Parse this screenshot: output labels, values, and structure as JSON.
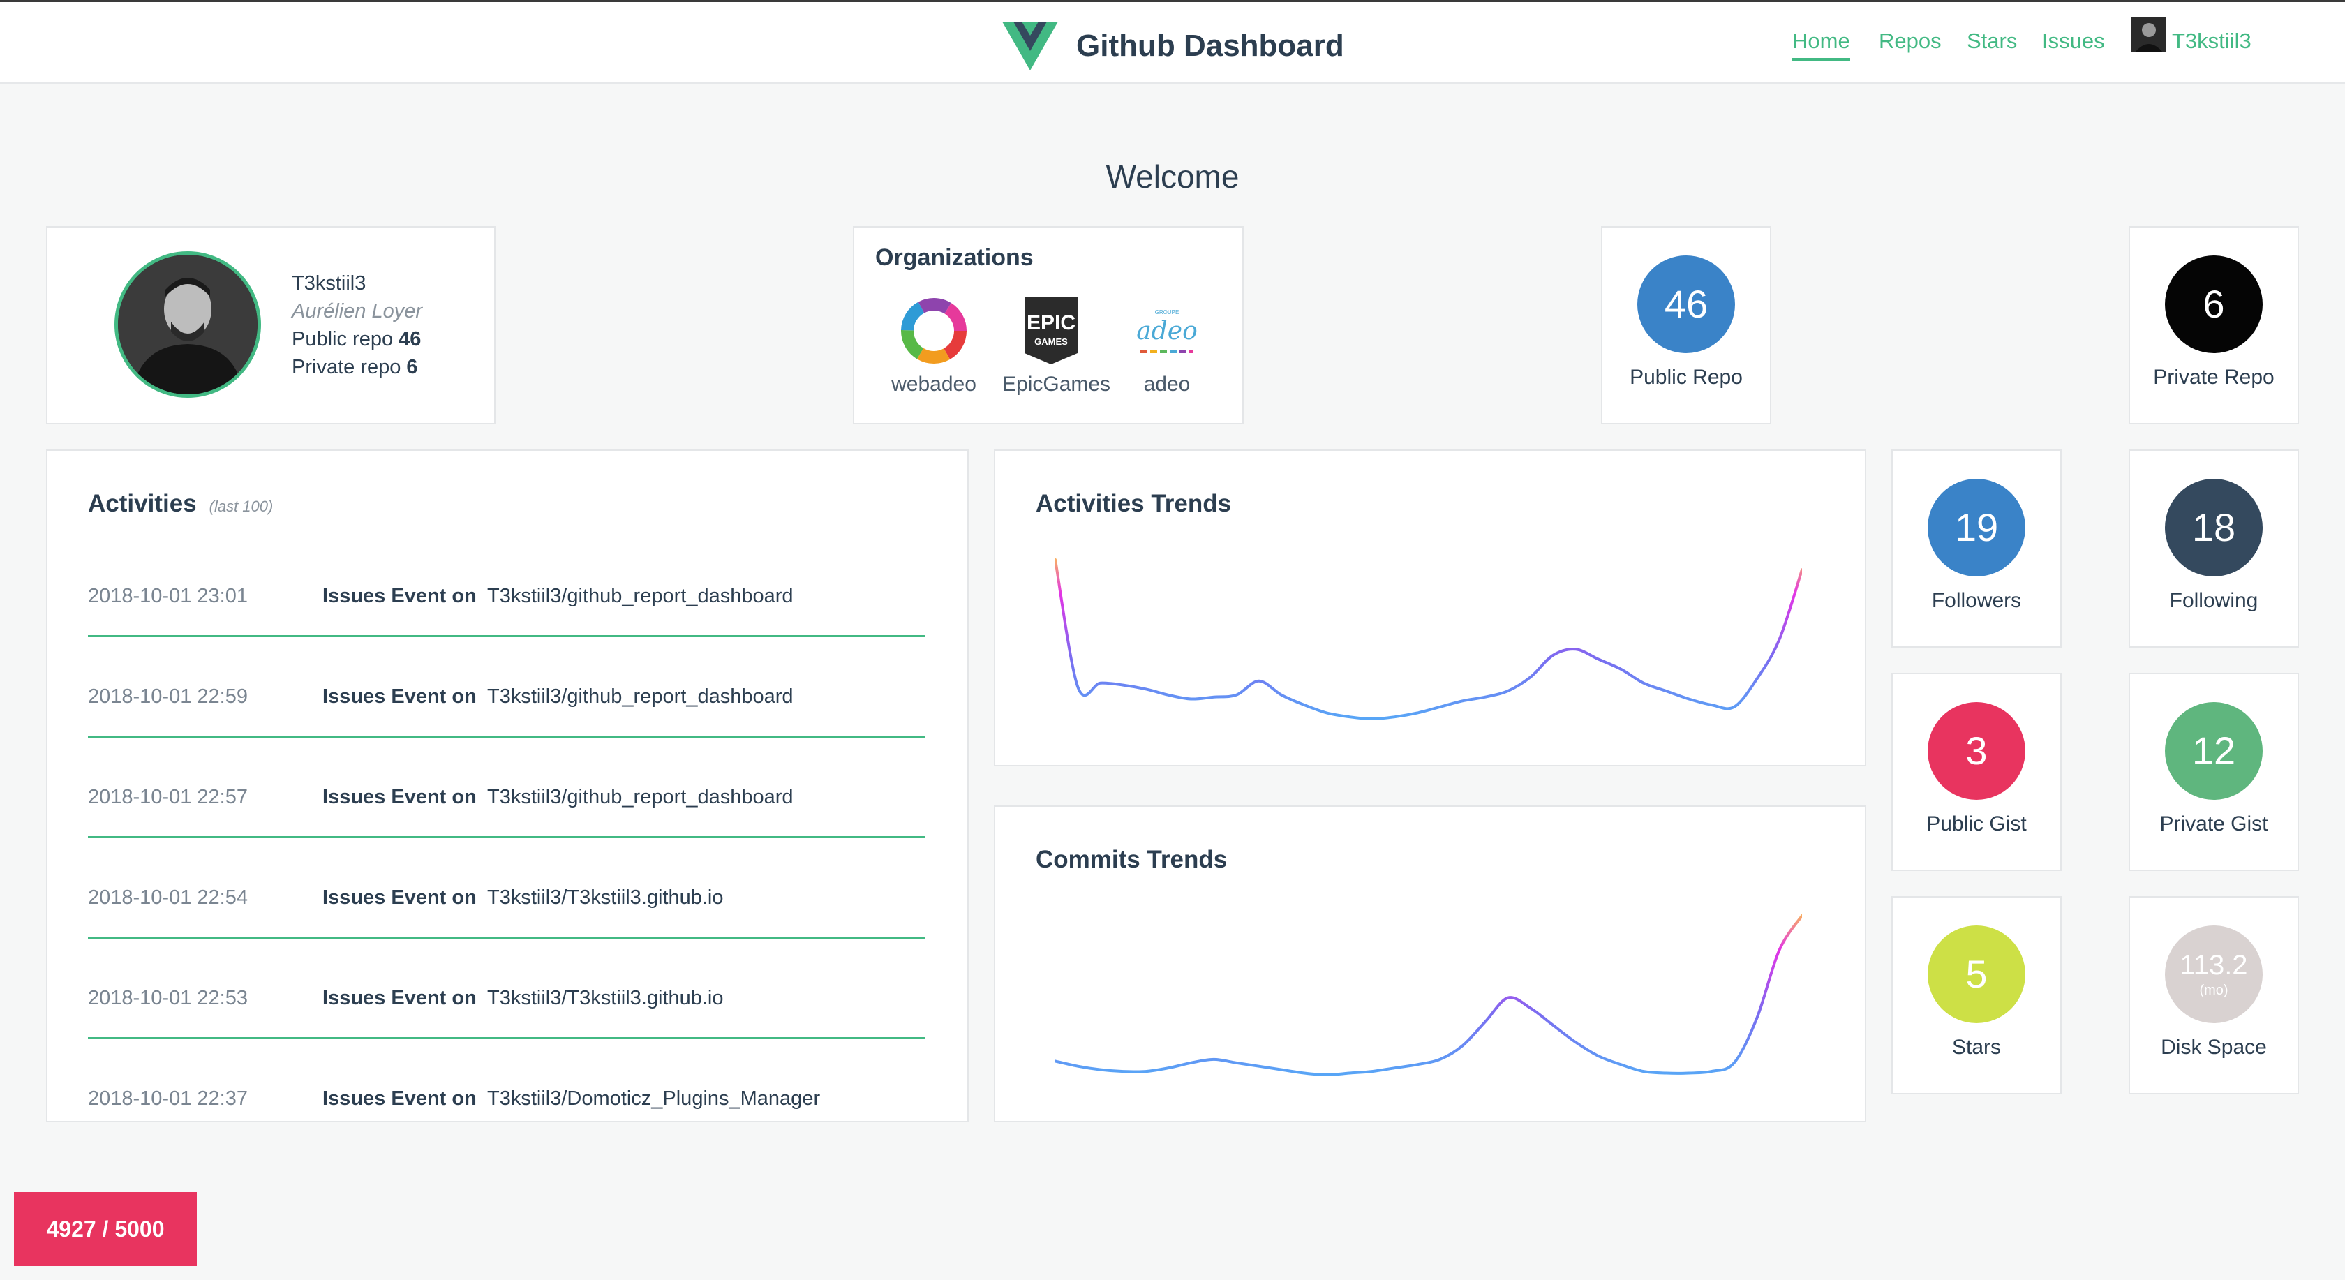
{
  "header": {
    "brand": "Github Dashboard",
    "logo_icon": "vue-logo-icon",
    "nav": [
      {
        "label": "Home",
        "active": true
      },
      {
        "label": "Repos",
        "active": false
      },
      {
        "label": "Stars",
        "active": false
      },
      {
        "label": "Issues",
        "active": false
      }
    ],
    "user": "T3kstiil3"
  },
  "welcome": "Welcome",
  "profile": {
    "login": "T3kstiil3",
    "name": "Aurélien Loyer",
    "public_repo_label": "Public repo",
    "public_repo_value": "46",
    "private_repo_label": "Private repo",
    "private_repo_value": "6"
  },
  "organizations": {
    "title": "Organizations",
    "items": [
      {
        "name": "webadeo",
        "icon": "webadeo-logo-icon"
      },
      {
        "name": "EpicGames",
        "icon": "epicgames-logo-icon",
        "logo_text_top": "EPIC",
        "logo_text_bottom": "GAMES"
      },
      {
        "name": "adeo",
        "icon": "adeo-logo-icon",
        "logo_text_top": "GROUPE",
        "logo_text_main": "adeo"
      }
    ]
  },
  "stats": {
    "public_repo": {
      "value": "46",
      "label": "Public Repo",
      "color": "#3a83c8"
    },
    "private_repo": {
      "value": "6",
      "label": "Private Repo",
      "color": "#050505"
    },
    "followers": {
      "value": "19",
      "label": "Followers",
      "color": "#3a83c8"
    },
    "following": {
      "value": "18",
      "label": "Following",
      "color": "#34495e"
    },
    "public_gist": {
      "value": "3",
      "label": "Public Gist",
      "color": "#e8345f"
    },
    "private_gist": {
      "value": "12",
      "label": "Private Gist",
      "color": "#5fb67e"
    },
    "stars": {
      "value": "5",
      "label": "Stars",
      "color": "#cde046"
    },
    "disk_space": {
      "value": "113.2",
      "unit": "(mo)",
      "label": "Disk Space",
      "color": "#d9d2d1"
    }
  },
  "activities": {
    "title": "Activities",
    "subtitle": "(last 100)",
    "items": [
      {
        "date": "2018-10-01 23:01",
        "type": "Issues Event on",
        "repo": "T3kstiil3/github_report_dashboard"
      },
      {
        "date": "2018-10-01 22:59",
        "type": "Issues Event on",
        "repo": "T3kstiil3/github_report_dashboard"
      },
      {
        "date": "2018-10-01 22:57",
        "type": "Issues Event on",
        "repo": "T3kstiil3/github_report_dashboard"
      },
      {
        "date": "2018-10-01 22:54",
        "type": "Issues Event on",
        "repo": "T3kstiil3/T3kstiil3.github.io"
      },
      {
        "date": "2018-10-01 22:53",
        "type": "Issues Event on",
        "repo": "T3kstiil3/T3kstiil3.github.io"
      },
      {
        "date": "2018-10-01 22:37",
        "type": "Issues Event on",
        "repo": "T3kstiil3/Domoticz_Plugins_Manager"
      }
    ]
  },
  "activities_trends": {
    "title": "Activities Trends"
  },
  "commits_trends": {
    "title": "Commits Trends"
  },
  "chart_data": [
    {
      "type": "line",
      "title": "Activities Trends",
      "values": [
        10,
        3.6,
        3.8,
        3.7,
        3.5,
        3.2,
        3.0,
        3.1,
        3.2,
        3.9,
        3.2,
        2.7,
        2.3,
        2.1,
        2.0,
        2.1,
        2.3,
        2.6,
        2.9,
        3.1,
        3.4,
        4.1,
        5.2,
        5.5,
        5.0,
        4.5,
        3.8,
        3.4,
        3.0,
        2.7,
        2.6,
        4.0,
        6.0,
        9.5
      ],
      "gradient": [
        "#ffd23c",
        "#e234e6",
        "#7a6cf0",
        "#52b0f7"
      ]
    },
    {
      "type": "line",
      "title": "Commits Trends",
      "values": [
        2.5,
        2.2,
        2.0,
        1.9,
        1.9,
        2.1,
        2.4,
        2.6,
        2.4,
        2.2,
        2.0,
        1.8,
        1.7,
        1.8,
        1.9,
        2.1,
        2.3,
        2.6,
        3.4,
        4.8,
        6.2,
        5.6,
        4.6,
        3.6,
        2.8,
        2.3,
        1.9,
        1.8,
        1.8,
        1.9,
        2.4,
        5.0,
        9.0,
        11.0
      ],
      "gradient": [
        "#ffd23c",
        "#e234e6",
        "#7a6cf0",
        "#52b0f7"
      ]
    }
  ],
  "rate_limit": "4927 / 5000"
}
